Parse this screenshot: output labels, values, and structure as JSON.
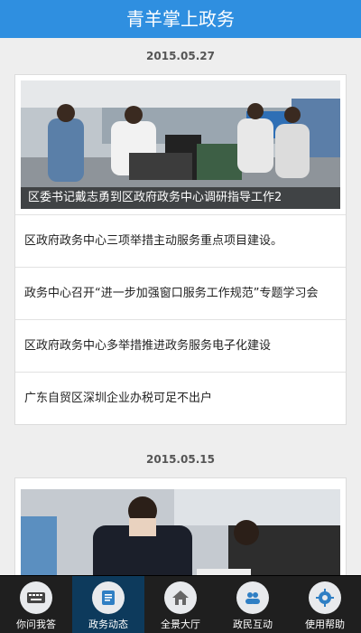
{
  "header": {
    "title": "青羊掌上政务"
  },
  "feed": [
    {
      "date": "2015.05.27",
      "hero_caption": "区委书记戴志勇到区政府政务中心调研指导工作2",
      "items": [
        "区政府政务中心三项举措主动服务重点项目建设。",
        "政务中心召开“进一步加强窗口服务工作规范”专题学习会",
        "区政府政务中心多举措推进政务服务电子化建设",
        "广东自贸区深圳企业办税可足不出户"
      ]
    },
    {
      "date": "2015.05.15"
    }
  ],
  "tabbar": {
    "tabs": [
      {
        "label": "你问我答",
        "icon": "keyboard-icon"
      },
      {
        "label": "政务动态",
        "icon": "news-icon",
        "active": true
      },
      {
        "label": "全景大厅",
        "icon": "home-icon"
      },
      {
        "label": "政民互动",
        "icon": "users-icon"
      },
      {
        "label": "使用帮助",
        "icon": "gear-icon"
      }
    ]
  },
  "colors": {
    "header": "#2f8fe0",
    "tabbar": "#1f1f1f",
    "tab_active": "#0d3a5c",
    "icon": "#2f7fc4"
  }
}
